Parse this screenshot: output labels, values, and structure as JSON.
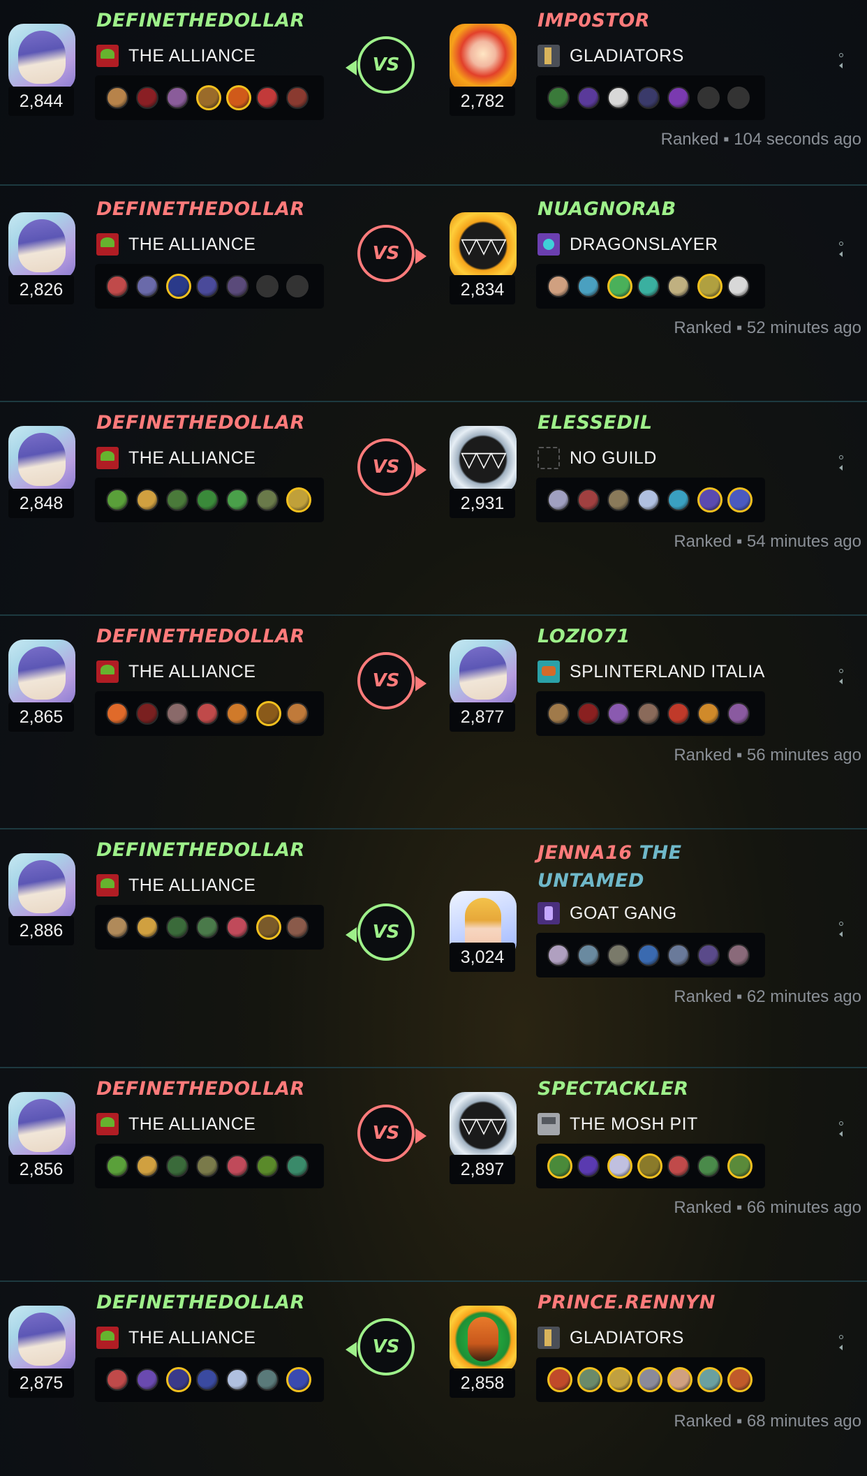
{
  "colors": {
    "win": "#9ef08a",
    "lose": "#ff7b7b",
    "gold": "#f2c01e",
    "panel": "#06080b",
    "divider": "#1d3a40"
  },
  "vs_label": "VS",
  "battles": [
    {
      "left": {
        "name": "DEFINETHEDOLLAR",
        "result": "win",
        "guild": "THE ALLIANCE",
        "guild_icon": "alliance-banner-icon",
        "avatar": "wizard-avatar",
        "rating": "2,844",
        "cards": [
          {
            "c": "#b7834a"
          },
          {
            "c": "#8a1f24"
          },
          {
            "c": "#8a5c9a"
          },
          {
            "c": "#9a6b2a",
            "gold": true
          },
          {
            "c": "#d05a1a",
            "gold": true
          },
          {
            "c": "#c23a3a"
          },
          {
            "c": "#8a3a30"
          }
        ]
      },
      "right": {
        "name": "IMP0STOR",
        "extra": "",
        "result": "lose",
        "guild": "GLADIATORS",
        "guild_icon": "gladiators-sword-icon",
        "avatar": "skull-avatar",
        "rating": "2,782",
        "cards": [
          {
            "c": "#3a7a3a"
          },
          {
            "c": "#5a3a9a"
          },
          {
            "c": "#d8d8d8"
          },
          {
            "c": "#3a3a6a"
          },
          {
            "c": "#7a3ab0"
          },
          {
            "empty": true
          },
          {
            "empty": true
          }
        ]
      },
      "winner": "left",
      "status": "Ranked ▪ 104 seconds ago"
    },
    {
      "left": {
        "name": "DEFINETHEDOLLAR",
        "result": "lose",
        "guild": "THE ALLIANCE",
        "guild_icon": "alliance-banner-icon",
        "avatar": "wizard-avatar",
        "rating": "2,826",
        "cards": [
          {
            "c": "#c04a4a"
          },
          {
            "c": "#6a6aaa"
          },
          {
            "c": "#2a3a8a",
            "gold": true
          },
          {
            "c": "#4a4a9a"
          },
          {
            "c": "#5a4a7a"
          },
          {
            "empty": true
          },
          {
            "empty": true
          }
        ]
      },
      "right": {
        "name": "NUAGNORAB",
        "extra": "",
        "result": "win",
        "guild": "DRAGONSLAYER",
        "guild_icon": "dragonslayer-orb-icon",
        "avatar": "monster-avatar",
        "rating": "2,834",
        "cards": [
          {
            "c": "#d0a080"
          },
          {
            "c": "#4aa0c0"
          },
          {
            "c": "#4ab05a",
            "gold": true
          },
          {
            "c": "#3ab0a0"
          },
          {
            "c": "#c0b080"
          },
          {
            "c": "#b0a040",
            "gold": true
          },
          {
            "c": "#d8d8d8"
          }
        ]
      },
      "winner": "right",
      "status": "Ranked ▪ 52 minutes ago"
    },
    {
      "left": {
        "name": "DEFINETHEDOLLAR",
        "result": "lose",
        "guild": "THE ALLIANCE",
        "guild_icon": "alliance-banner-icon",
        "avatar": "wizard-avatar",
        "rating": "2,848",
        "cards": [
          {
            "c": "#5aa03a"
          },
          {
            "c": "#d0a040"
          },
          {
            "c": "#4a7a3a"
          },
          {
            "c": "#3a8a3a"
          },
          {
            "c": "#4aa04a"
          },
          {
            "c": "#6a7a4a"
          },
          {
            "c": "#c0a03a",
            "gold": true
          }
        ]
      },
      "right": {
        "name": "ELESSEDIL",
        "extra": "",
        "result": "win",
        "guild": "NO GUILD",
        "guild_icon": "no-guild-icon",
        "avatar": "monster-silver-avatar",
        "rating": "2,931",
        "cards": [
          {
            "c": "#a0a0c0"
          },
          {
            "c": "#a04040"
          },
          {
            "c": "#8a7a5a"
          },
          {
            "c": "#b0c0e0"
          },
          {
            "c": "#3aa0c0"
          },
          {
            "c": "#5a4ab0",
            "gold": true
          },
          {
            "c": "#4a5ac0",
            "gold": true
          }
        ]
      },
      "winner": "right",
      "status": "Ranked ▪ 54 minutes ago"
    },
    {
      "left": {
        "name": "DEFINETHEDOLLAR",
        "result": "lose",
        "guild": "THE ALLIANCE",
        "guild_icon": "alliance-banner-icon",
        "avatar": "wizard-avatar",
        "rating": "2,865",
        "cards": [
          {
            "c": "#e06a2a"
          },
          {
            "c": "#7a2020"
          },
          {
            "c": "#8a6a6a"
          },
          {
            "c": "#c04a4a"
          },
          {
            "c": "#d07a2a"
          },
          {
            "c": "#8a5a1a",
            "gold": true
          },
          {
            "c": "#c07a3a"
          }
        ]
      },
      "right": {
        "name": "LOZIO71",
        "extra": "",
        "result": "win",
        "guild": "SPLINTERLAND ITALIA",
        "guild_icon": "italia-fish-icon",
        "avatar": "wizard-avatar",
        "rating": "2,877",
        "cards": [
          {
            "c": "#a07a4a"
          },
          {
            "c": "#8a2020"
          },
          {
            "c": "#8a5ab0"
          },
          {
            "c": "#8a6a5a"
          },
          {
            "c": "#c03a2a"
          },
          {
            "c": "#d08a2a"
          },
          {
            "c": "#8a5aa0"
          }
        ]
      },
      "winner": "right",
      "status": "Ranked ▪ 56 minutes ago"
    },
    {
      "left": {
        "name": "DEFINETHEDOLLAR",
        "result": "win",
        "guild": "THE ALLIANCE",
        "guild_icon": "alliance-banner-icon",
        "avatar": "wizard-avatar",
        "rating": "2,886",
        "cards": [
          {
            "c": "#b08a5a"
          },
          {
            "c": "#d0a040"
          },
          {
            "c": "#3a6a3a"
          },
          {
            "c": "#4a7a4a"
          },
          {
            "c": "#c04a5a"
          },
          {
            "c": "#7a5a2a",
            "gold": true
          },
          {
            "c": "#8a5a4a"
          }
        ]
      },
      "right": {
        "name": "JENNA16",
        "extra": "THE UNTAMED",
        "result": "lose",
        "guild": "GOAT GANG",
        "guild_icon": "goat-gang-icon",
        "avatar": "princess-avatar",
        "rating": "3,024",
        "cards": [
          {
            "c": "#b0a0c0"
          },
          {
            "c": "#6a8aa0"
          },
          {
            "c": "#7a7a6a"
          },
          {
            "c": "#3a6ab0"
          },
          {
            "c": "#6a7a9a"
          },
          {
            "c": "#5a4a8a"
          },
          {
            "c": "#8a6a7a"
          }
        ]
      },
      "winner": "left",
      "status": "Ranked ▪ 62 minutes ago"
    },
    {
      "left": {
        "name": "DEFINETHEDOLLAR",
        "result": "lose",
        "guild": "THE ALLIANCE",
        "guild_icon": "alliance-banner-icon",
        "avatar": "wizard-avatar",
        "rating": "2,856",
        "cards": [
          {
            "c": "#5aa03a"
          },
          {
            "c": "#d0a040"
          },
          {
            "c": "#3a6a3a"
          },
          {
            "c": "#7a7a4a"
          },
          {
            "c": "#c04a5a"
          },
          {
            "c": "#5a8a2a"
          },
          {
            "c": "#3a8a6a"
          }
        ]
      },
      "right": {
        "name": "SPECTACKLER",
        "extra": "",
        "result": "win",
        "guild": "THE MOSH PIT",
        "guild_icon": "mosh-pit-hammer-icon",
        "avatar": "monster-silver-avatar",
        "rating": "2,897",
        "cards": [
          {
            "c": "#4a8a3a",
            "gold": true
          },
          {
            "c": "#5a3ab0"
          },
          {
            "c": "#c0c0e0",
            "gold": true
          },
          {
            "c": "#8a7a2a",
            "gold": true
          },
          {
            "c": "#c04a4a"
          },
          {
            "c": "#4a8a4a"
          },
          {
            "c": "#5a8a3a",
            "gold": true
          }
        ]
      },
      "winner": "right",
      "status": "Ranked ▪ 66 minutes ago"
    },
    {
      "left": {
        "name": "DEFINETHEDOLLAR",
        "result": "win",
        "guild": "THE ALLIANCE",
        "guild_icon": "alliance-banner-icon",
        "avatar": "wizard-avatar",
        "rating": "2,875",
        "cards": [
          {
            "c": "#c04a4a"
          },
          {
            "c": "#6a4ab0"
          },
          {
            "c": "#3a3a8a",
            "gold": true
          },
          {
            "c": "#3a4aa0"
          },
          {
            "c": "#b0c0e0"
          },
          {
            "c": "#5a7a7a"
          },
          {
            "c": "#3a4ab0",
            "gold": true
          }
        ]
      },
      "right": {
        "name": "PRINCE.RENNYN",
        "extra": "",
        "result": "lose",
        "guild": "GLADIATORS",
        "guild_icon": "gladiators-sword-icon",
        "avatar": "tiger-avatar",
        "rating": "2,858",
        "cards": [
          {
            "c": "#c04a2a",
            "gold": true
          },
          {
            "c": "#6a8a6a",
            "gold": true
          },
          {
            "c": "#c0a040",
            "gold": true
          },
          {
            "c": "#8a8a9a",
            "gold": true
          },
          {
            "c": "#d0a080",
            "gold": true
          },
          {
            "c": "#6aa0a0",
            "gold": true
          },
          {
            "c": "#c05a2a",
            "gold": true
          }
        ]
      },
      "winner": "left",
      "status": "Ranked ▪ 68 minutes ago"
    }
  ]
}
